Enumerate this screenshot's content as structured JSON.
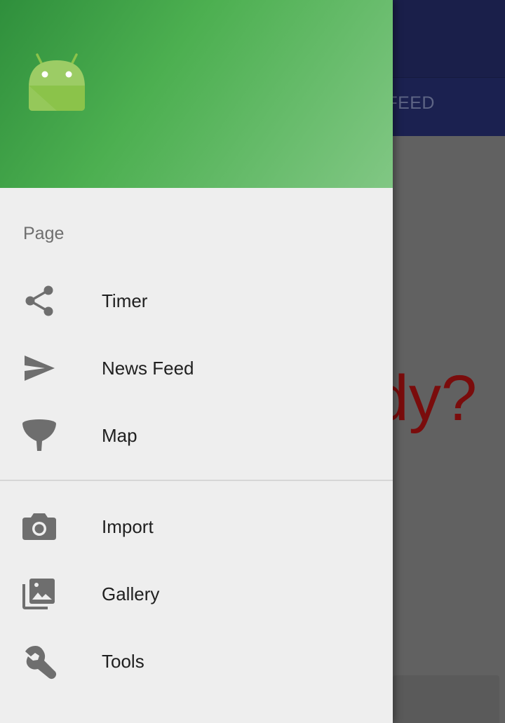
{
  "background_app": {
    "tab_label": "FEED",
    "headline": "dy?"
  },
  "drawer": {
    "section_title": "Page",
    "primary_items": [
      {
        "label": "Timer",
        "icon": "share-icon"
      },
      {
        "label": "News Feed",
        "icon": "send-icon"
      },
      {
        "label": "Map",
        "icon": "map-icon"
      }
    ],
    "secondary_items": [
      {
        "label": "Import",
        "icon": "camera-icon"
      },
      {
        "label": "Gallery",
        "icon": "gallery-icon"
      },
      {
        "label": "Tools",
        "icon": "wrench-icon"
      }
    ]
  },
  "colors": {
    "header_green": "#4caf50",
    "toolbar_navy": "#1a1f4a",
    "headline_red": "#7a0c0c",
    "drawer_bg": "#eeeeee",
    "icon_gray": "#6e6e6e"
  }
}
